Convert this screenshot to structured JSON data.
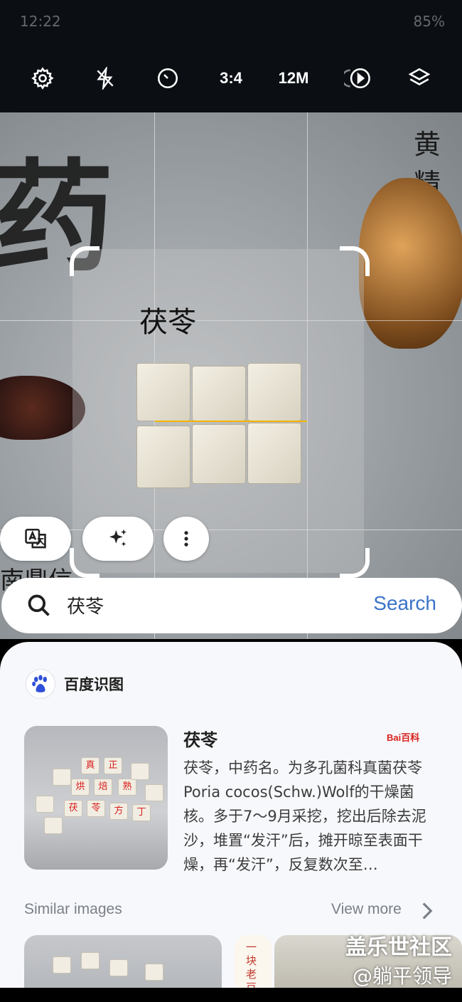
{
  "status_bar": {
    "time": "12:22",
    "right": "85%"
  },
  "camera_bar": {
    "items": [
      {
        "icon": "gear-icon"
      },
      {
        "icon": "flash-off-icon"
      },
      {
        "icon": "timer-icon"
      },
      {
        "label": "3:4"
      },
      {
        "label": "12M"
      },
      {
        "icon": "motion-photo-icon"
      },
      {
        "icon": "layers-icon"
      }
    ]
  },
  "viewfinder": {
    "object_label": "茯苓",
    "bg_label_top": "黄精",
    "bg_label_bottom": "南鼎信"
  },
  "action_buttons": [
    {
      "icon": "translate-icon"
    },
    {
      "icon": "sparkle-icon"
    },
    {
      "icon": "more-vert-icon"
    }
  ],
  "search": {
    "query": "茯苓",
    "button_label": "Search"
  },
  "result": {
    "source_name": "百度识图",
    "title": "茯苓",
    "badge": "Bai百科",
    "description": "茯苓，中药名。为多孔菌科真菌茯苓Poria cocos(Schw.)Wolf的干燥菌核。多于7～9月采挖，挖出后除去泥沙，堆置“发汗”后，摊开晾至表面干燥，再“发汗”，反复数次至…",
    "thumb_chars": [
      "真",
      "正",
      "烘",
      "焙",
      "熟",
      "茯",
      "苓",
      "方",
      "丁"
    ]
  },
  "similar": {
    "label": "Similar images",
    "view_more": "View more",
    "side_text": "一块老豆"
  },
  "watermark": {
    "line1": "盖乐世社区",
    "line2": "@躺平领导"
  },
  "colors": {
    "accent": "#3b73c9",
    "scan_line": "#f4b400",
    "baidu_red": "#d8201c"
  }
}
